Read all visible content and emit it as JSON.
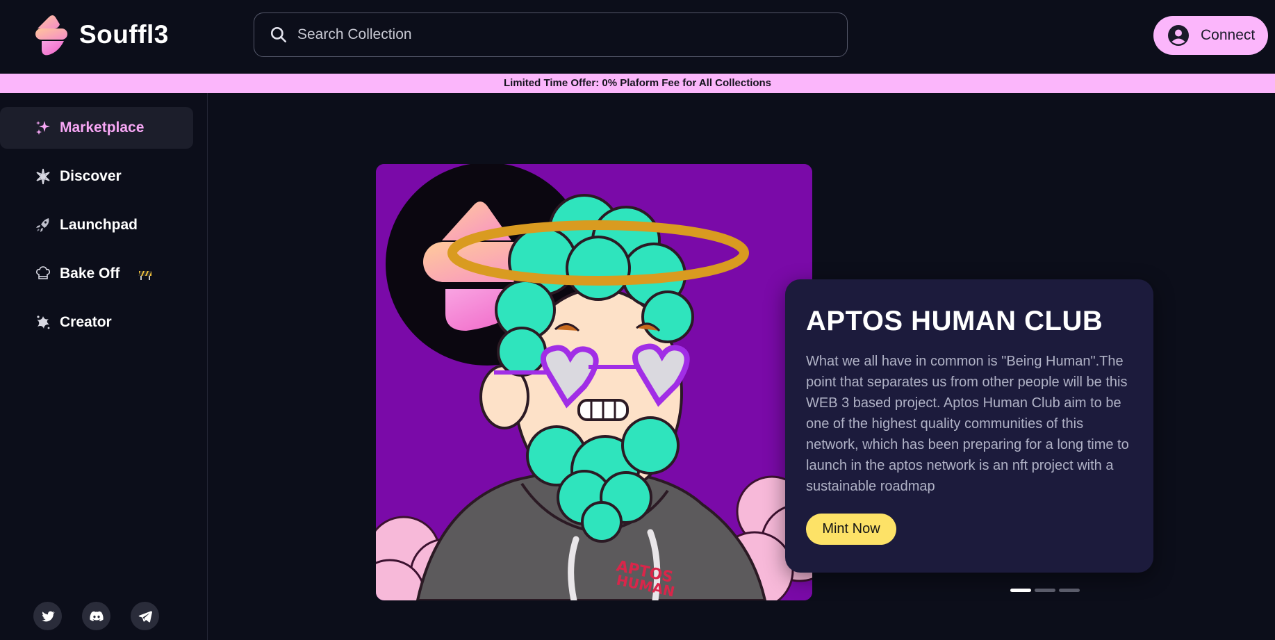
{
  "app": {
    "name": "Souffl3"
  },
  "header": {
    "search_placeholder": "Search Collection",
    "connect_label": "Connect"
  },
  "promo": {
    "text": "Limited Time Offer: 0% Plaform Fee for All Collections"
  },
  "sidebar": {
    "items": [
      {
        "label": "Marketplace",
        "icon": "sparkles-icon",
        "active": true
      },
      {
        "label": "Discover",
        "icon": "compass-star-icon",
        "active": false
      },
      {
        "label": "Launchpad",
        "icon": "rocket-icon",
        "active": false
      },
      {
        "label": "Bake Off",
        "icon": "chef-hat-icon",
        "active": false,
        "badge": "construction-icon"
      },
      {
        "label": "Creator",
        "icon": "creator-splash-icon",
        "active": false
      }
    ],
    "socials": [
      "twitter-icon",
      "discord-icon",
      "telegram-icon"
    ]
  },
  "featured": {
    "title": "APTOS HUMAN CLUB",
    "description": "What we all have in common is \"Being Human\".The point that separates us from other people will be this WEB 3 based project. Aptos Human Club aim to be one of the highest quality communities of this network, which has been preparing for a long time to launch in the aptos network is an nft project with a sustainable roadmap",
    "cta_label": "Mint Now",
    "carousel_total": 3,
    "carousel_active": 1
  },
  "colors": {
    "background": "#0c0e1a",
    "accent_pink": "#fbb6fb",
    "active_text": "#f7a7f5",
    "card": "#1c1b3c",
    "cta_yellow": "#fde267",
    "nft_background": "#7a0aa8"
  }
}
